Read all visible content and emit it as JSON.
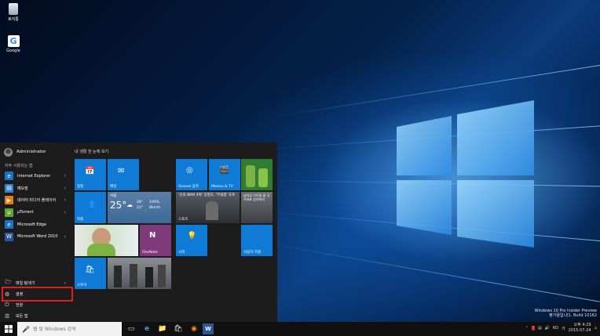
{
  "desktop": {
    "icons": [
      {
        "label": "휴지통",
        "icon": "recycle-bin-icon"
      },
      {
        "label": "Google",
        "icon": "google-shortcut-icon"
      }
    ],
    "watermark": {
      "line1": "Windows 10 Pro Insider Preview",
      "line2": "평가용입니다. Build 10162"
    }
  },
  "start_menu": {
    "user_name": "Administrator",
    "most_used_label": "자주 사용되는 앱",
    "apps": [
      {
        "label": "Internet Explorer",
        "icon": "internet-explorer-icon",
        "color": "#1a72c6",
        "has_submenu": true
      },
      {
        "label": "메모장",
        "icon": "notepad-icon",
        "color": "#3a7dc9",
        "has_submenu": true
      },
      {
        "label": "데이터 미디어 플레이어",
        "icon": "media-player-icon",
        "color": "#e47b13",
        "has_submenu": true
      },
      {
        "label": "µTorrent",
        "icon": "utorrent-icon",
        "color": "#5ba531",
        "has_submenu": true
      },
      {
        "label": "Microsoft Edge",
        "icon": "edge-icon",
        "color": "#1a72c6",
        "has_submenu": false
      },
      {
        "label": "Microsoft Word 2010",
        "icon": "word-icon",
        "color": "#2b5797",
        "has_submenu": true
      }
    ],
    "bottom": {
      "file_explorer": "파일 탐색기",
      "settings": "설정",
      "power": "전원",
      "all_apps": "모든 앱"
    },
    "tiles_header": "내 생활 한 눈에 보기",
    "tiles": {
      "calendar": "일정",
      "mail": "메일",
      "people": "피플",
      "weather_city": "서울",
      "weather_temp": "25°",
      "weather_hi": "28°",
      "weather_lo": "23°",
      "weather_humidity": "100%",
      "weather_wind": "8km/h",
      "onenote": "OneNote",
      "store": "스토어",
      "groove": "Groove 음악",
      "movies": "Movies & TV",
      "sports_headline": "'신의 WAR 4위' 강정호, '무실점' 호투",
      "sports": "스포츠",
      "news_headline": "남아공 기다림 끝 국가대표 승리까지",
      "tips": "시작",
      "get_started": "사용자 지원"
    }
  },
  "taskbar": {
    "search_placeholder": "웹 및 Windows 검색",
    "pinned": [
      {
        "icon": "task-view-icon"
      },
      {
        "icon": "edge-icon"
      },
      {
        "icon": "file-explorer-icon"
      },
      {
        "icon": "store-icon"
      },
      {
        "icon": "firefox-icon"
      },
      {
        "icon": "word-icon"
      }
    ],
    "language": "KO",
    "ime_indicator": "가",
    "time": "오후 4:29",
    "date": "2015-07-24"
  }
}
